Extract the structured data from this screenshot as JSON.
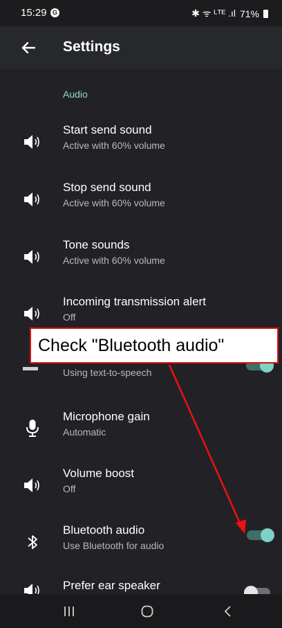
{
  "status_bar": {
    "time": "15:29",
    "g_icon": "G",
    "indicators": "✱ ᯤ ᴸᵀᴱ .ıl",
    "battery": "71%"
  },
  "app_bar": {
    "title": "Settings"
  },
  "section": {
    "label": "Audio"
  },
  "items": [
    {
      "title": "Start send sound",
      "subtitle": "Active with 60% volume",
      "icon": "speaker-icon"
    },
    {
      "title": "Stop send sound",
      "subtitle": "Active with 60% volume",
      "icon": "speaker-icon"
    },
    {
      "title": "Tone sounds",
      "subtitle": "Active with 60% volume",
      "icon": "speaker-icon"
    },
    {
      "title": "Incoming transmission alert",
      "subtitle": "Off",
      "icon": "speaker-icon"
    },
    {
      "title": "",
      "subtitle": "Using text-to-speech",
      "icon": "tts-icon",
      "toggle": "on"
    },
    {
      "title": "Microphone gain",
      "subtitle": "Automatic",
      "icon": "microphone-icon"
    },
    {
      "title": "Volume boost",
      "subtitle": "Off",
      "icon": "speaker-icon"
    },
    {
      "title": "Bluetooth audio",
      "subtitle": "Use Bluetooth for audio",
      "icon": "bluetooth-icon",
      "toggle": "on"
    },
    {
      "title": "Prefer ear speaker",
      "subtitle": "",
      "icon": "speaker-icon",
      "toggle": "off"
    }
  ],
  "annotation": {
    "text": "Check \"Bluetooth audio\"",
    "color": "#dd1111"
  },
  "nav_bar": {
    "recents": "recents-icon",
    "home": "home-icon",
    "back": "back-icon"
  },
  "colors": {
    "accent": "#7fd1c6",
    "background": "#222226",
    "app_bar": "#26282b"
  }
}
